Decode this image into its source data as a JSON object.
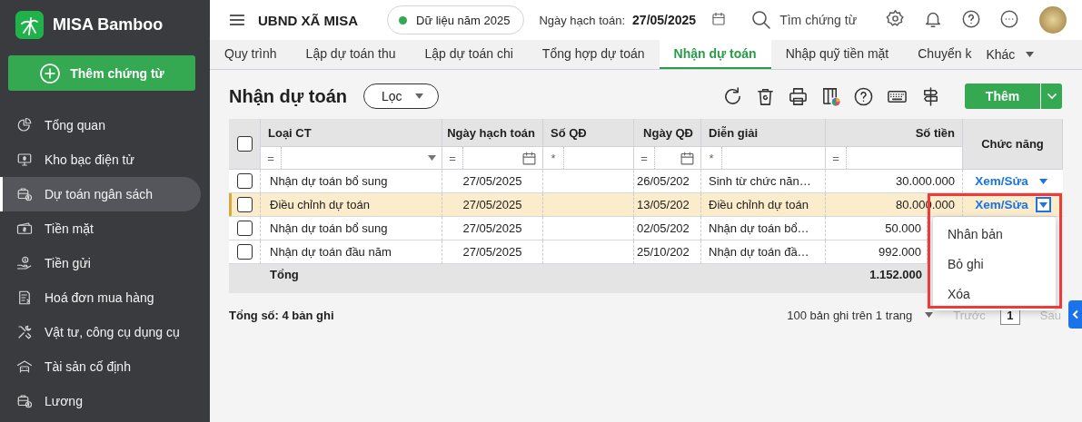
{
  "app": {
    "name": "MISA Bamboo"
  },
  "sidebar": {
    "add_button": "Thêm chứng từ",
    "items": [
      {
        "label": "Tổng quan",
        "selected": false
      },
      {
        "label": "Kho bạc điện tử",
        "selected": false
      },
      {
        "label": "Dự toán ngân sách",
        "selected": true
      },
      {
        "label": "Tiền mặt",
        "selected": false
      },
      {
        "label": "Tiền gửi",
        "selected": false
      },
      {
        "label": "Hoá đơn mua hàng",
        "selected": false
      },
      {
        "label": "Vật tư, công cụ dụng cụ",
        "selected": false
      },
      {
        "label": "Tài sản cố định",
        "selected": false
      },
      {
        "label": "Lương",
        "selected": false
      }
    ]
  },
  "header": {
    "org": "UBND XÃ MISA",
    "data_year": "Dữ liệu năm 2025",
    "posting_date_label": "Ngày hạch toán:",
    "posting_date": "27/05/2025",
    "search_placeholder": "Tìm chứng từ"
  },
  "tabs": [
    {
      "label": "Quy trình",
      "selected": false
    },
    {
      "label": "Lập dự toán thu",
      "selected": false
    },
    {
      "label": "Lập dự toán chi",
      "selected": false
    },
    {
      "label": "Tổng hợp dự toán",
      "selected": false
    },
    {
      "label": "Nhận dự toán",
      "selected": true
    },
    {
      "label": "Nhập quỹ tiền mặt",
      "selected": false
    },
    {
      "label": "Chuyển k",
      "selected": false
    }
  ],
  "more_tab": "Khác",
  "page": {
    "title": "Nhận dự toán",
    "filter": "Lọc",
    "add_button": "Thêm"
  },
  "table": {
    "all_checked": false,
    "columns": [
      {
        "label": "Loại CT",
        "filter": {
          "operator": "=",
          "kind": "dropdown"
        }
      },
      {
        "label": "Ngày hạch toán",
        "filter": {
          "operator": "=",
          "kind": "date"
        }
      },
      {
        "label": "Số QĐ",
        "filter": {
          "operator": "*",
          "kind": "text"
        }
      },
      {
        "label": "Ngày QĐ",
        "filter": {
          "operator": "=",
          "kind": "date"
        }
      },
      {
        "label": "Diễn giải",
        "filter": {
          "operator": "*",
          "kind": "text"
        }
      },
      {
        "label": "Số tiền",
        "filter": {
          "operator": "=",
          "kind": "text"
        }
      },
      {
        "label": "Chức năng"
      }
    ],
    "rows": [
      {
        "checked": false,
        "selected": false,
        "menu_open": false,
        "cells": [
          "Nhận dự toán bổ sung",
          "27/05/2025",
          "",
          "26/05/202",
          "Sinh từ chức năn…",
          "30.000.000"
        ],
        "action": "Xem/Sửa"
      },
      {
        "checked": false,
        "selected": true,
        "menu_open": true,
        "cells": [
          "Điều chỉnh dự toán",
          "27/05/2025",
          "",
          "13/05/202",
          "Điều chỉnh dự toán",
          "80.000.000"
        ],
        "action": "Xem/Sửa"
      },
      {
        "checked": false,
        "selected": false,
        "cells": [
          "Nhận dự toán bổ sung",
          "27/05/2025",
          "",
          "02/05/202",
          "Nhận dự toán bổ…",
          "50.000"
        ]
      },
      {
        "checked": false,
        "selected": false,
        "cells": [
          "Nhận dự toán đầu năm",
          "27/05/2025",
          "",
          "25/10/202",
          "Nhận dự toán đầ…",
          "992.000"
        ]
      }
    ],
    "total": {
      "label": "Tổng",
      "amount": "1.152.000"
    },
    "row_menu": {
      "items": [
        "Nhân bản",
        "Bỏ ghi",
        "Xóa"
      ]
    }
  },
  "annotation": {
    "kind": "frame"
  },
  "footer": {
    "count": "Tổng số: 4 bản ghi",
    "page_size": "100 bản ghi trên 1 trang",
    "prev": "Trước",
    "prev_disabled": true,
    "page": "1",
    "next": "Sau",
    "next_disabled": true
  }
}
